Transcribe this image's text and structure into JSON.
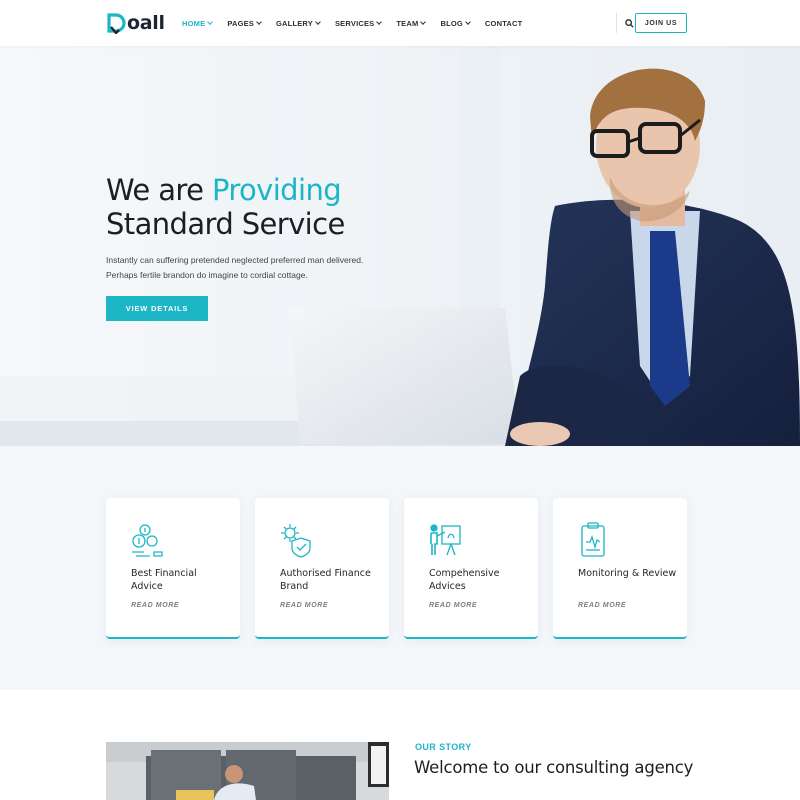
{
  "brand": {
    "name": "oall",
    "accent": "#1cb6c6",
    "dark": "#1d2630"
  },
  "nav": {
    "items": [
      {
        "label": "HOME",
        "active": true,
        "dropdown": true
      },
      {
        "label": "PAGES",
        "active": false,
        "dropdown": true
      },
      {
        "label": "GALLERY",
        "active": false,
        "dropdown": true
      },
      {
        "label": "SERVICES",
        "active": false,
        "dropdown": true
      },
      {
        "label": "TEAM",
        "active": false,
        "dropdown": true
      },
      {
        "label": "BLOG",
        "active": false,
        "dropdown": true
      },
      {
        "label": "CONTACT",
        "active": false,
        "dropdown": false
      }
    ],
    "search_icon": "search-icon",
    "join_label": "JOIN US"
  },
  "hero": {
    "title_prefix": "We are ",
    "title_accent": "Providing",
    "title_line2": "Standard Service",
    "description": "Instantly can suffering pretended neglected preferred man delivered. Perhaps fertile brandon do imagine to cordial cottage.",
    "button_label": "VIEW DETAILS"
  },
  "features": [
    {
      "icon": "finance-coins-icon",
      "title": "Best Financial Advice",
      "link": "READ MORE"
    },
    {
      "icon": "gear-shield-icon",
      "title": "Authorised Finance Brand",
      "link": "READ MORE"
    },
    {
      "icon": "presentation-icon",
      "title": "Compehensive Advices",
      "link": "READ MORE"
    },
    {
      "icon": "clipboard-chart-icon",
      "title": "Monitoring & Review",
      "link": "READ MORE"
    }
  ],
  "about": {
    "kicker": "OUR STORY",
    "title": "Welcome to our consulting agency"
  }
}
